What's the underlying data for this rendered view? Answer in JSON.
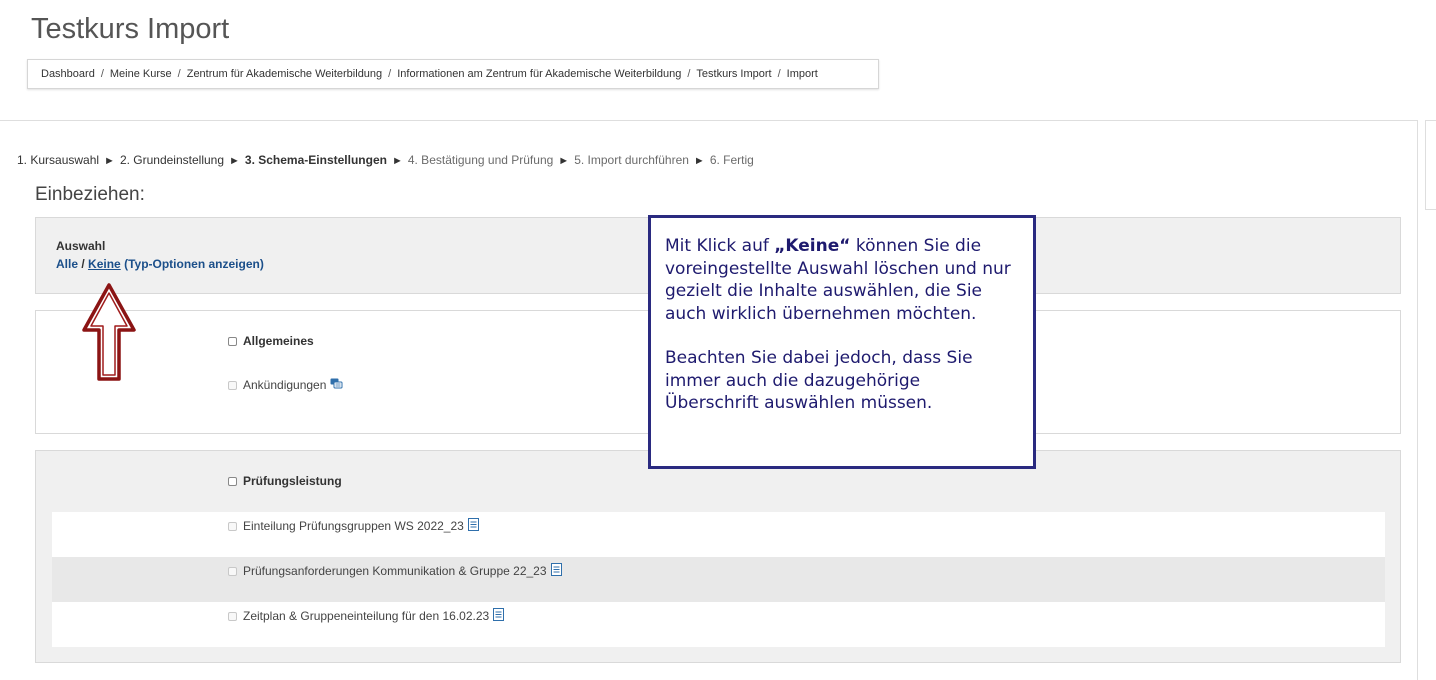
{
  "page": {
    "title": "Testkurs Import"
  },
  "breadcrumb": [
    "Dashboard",
    "Meine Kurse",
    "Zentrum für Akademische Weiterbildung",
    "Informationen am Zentrum für Akademische Weiterbildung",
    "Testkurs Import",
    "Import"
  ],
  "breadcrumb_separator": "/",
  "steps": {
    "separator": "►",
    "items": [
      {
        "label": "1. Kursauswahl",
        "state": "done"
      },
      {
        "label": "2. Grundeinstellung",
        "state": "done"
      },
      {
        "label": "3. Schema-Einstellungen",
        "state": "current"
      },
      {
        "label": "4. Bestätigung und Prüfung",
        "state": "future"
      },
      {
        "label": "5. Import durchführen",
        "state": "future"
      },
      {
        "label": "6. Fertig",
        "state": "future"
      }
    ]
  },
  "include": {
    "heading": "Einbeziehen:",
    "select_label": "Auswahl",
    "all_link": "Alle",
    "slash": "/",
    "none_link": "Keine",
    "type_options_link": "(Typ-Optionen anzeigen)"
  },
  "sections": [
    {
      "name": "Allgemeines",
      "checked": false,
      "items": [
        {
          "name": "Ankündigungen",
          "checked": false,
          "disabled": true,
          "icon": "forum-icon"
        }
      ]
    },
    {
      "name": "Prüfungsleistung",
      "checked": false,
      "items": [
        {
          "name": "Einteilung Prüfungsgruppen WS 2022_23",
          "checked": false,
          "disabled": true,
          "icon": "file-icon"
        },
        {
          "name": "Prüfungsanforderungen Kommunikation & Gruppe 22_23",
          "checked": false,
          "disabled": true,
          "icon": "file-icon"
        },
        {
          "name": "Zeitplan & Gruppeneinteilung für den 16.02.23",
          "checked": false,
          "disabled": true,
          "icon": "file-icon"
        }
      ]
    }
  ],
  "callout": {
    "line_prefix": "Mit Klick auf ",
    "emphasis": "„Keine“",
    "line_suffix": " können Sie die voreingestellte Auswahl löschen und nur gezielt die Inhalte auswählen, die Sie auch wirklich übernehmen möchten.",
    "paragraph2": "Beachten Sie dabei jedoch, dass Sie immer auch die dazugehörige Überschrift auswählen müssen."
  },
  "colors": {
    "link": "#1b4f8a",
    "callout_border": "#2a2a80",
    "callout_text": "#1e1a6e",
    "arrow": "#8b1414"
  }
}
